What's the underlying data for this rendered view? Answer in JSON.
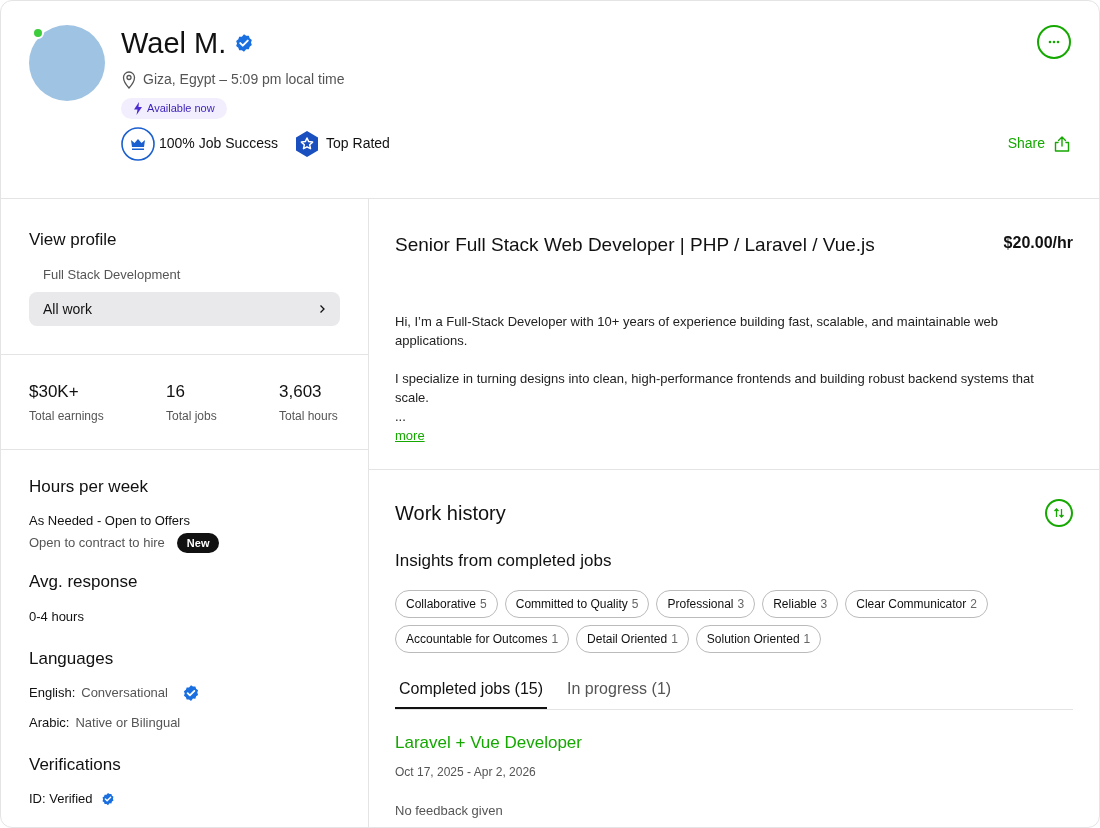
{
  "profile": {
    "name": "Wael M.",
    "verified": true,
    "online": true,
    "location": "Giza, Egypt – 5:09 pm local time",
    "availability": "Available now",
    "badges": [
      {
        "kind": "job_success",
        "label": "100% Job Success"
      },
      {
        "kind": "top_rated",
        "label": "Top Rated"
      }
    ],
    "share": "Share"
  },
  "sidebar": {
    "title": "View profile",
    "category": "Full Stack Development",
    "items": [
      {
        "label": "All work",
        "selected": true
      }
    ],
    "stats": [
      {
        "value": "$30K+",
        "label": "Total earnings"
      },
      {
        "value": "16",
        "label": "Total jobs"
      },
      {
        "value": "3,603",
        "label": "Total hours"
      }
    ],
    "hours": {
      "title": "Hours per week",
      "value": "As Needed - Open to Offers",
      "contract": "Open to contract to hire",
      "badge": "New"
    },
    "response": {
      "title": "Avg. response",
      "value": "0-4 hours"
    },
    "languages": {
      "title": "Languages",
      "items": [
        {
          "name": "English:",
          "level": "Conversational",
          "verified": true
        },
        {
          "name": "Arabic:",
          "level": "Native or Bilingual",
          "verified": false
        }
      ]
    },
    "verifications": {
      "title": "Verifications",
      "items": [
        {
          "label": "ID: Verified",
          "verified": true
        }
      ]
    }
  },
  "overview": {
    "title": "Senior Full Stack Web Developer | PHP / Laravel / Vue.js",
    "rate": "$20.00/hr",
    "paragraphs": [
      "Hi, I’m a Full-Stack Developer with 10+ years of experience building fast, scalable, and maintainable web applications.",
      "I specialize in turning designs into clean, high-performance frontends and building robust backend systems that scale.",
      "..."
    ],
    "more": "more"
  },
  "work_history": {
    "title": "Work history",
    "insights_title": "Insights from completed jobs",
    "insights": [
      {
        "label": "Collaborative",
        "count": "5"
      },
      {
        "label": "Committed to Quality",
        "count": "5"
      },
      {
        "label": "Professional",
        "count": "3"
      },
      {
        "label": "Reliable",
        "count": "3"
      },
      {
        "label": "Clear Communicator",
        "count": "2"
      },
      {
        "label": "Accountable for Outcomes",
        "count": "1"
      },
      {
        "label": "Detail Oriented",
        "count": "1"
      },
      {
        "label": "Solution Oriented",
        "count": "1"
      }
    ],
    "tabs": [
      {
        "label": "Completed jobs (15)",
        "selected": true
      },
      {
        "label": "In progress (1)",
        "selected": false
      }
    ],
    "jobs": [
      {
        "title": "Laravel + Vue Developer",
        "dates": "Oct 17, 2025 - Apr 2, 2026",
        "feedback": "No feedback given"
      }
    ]
  }
}
